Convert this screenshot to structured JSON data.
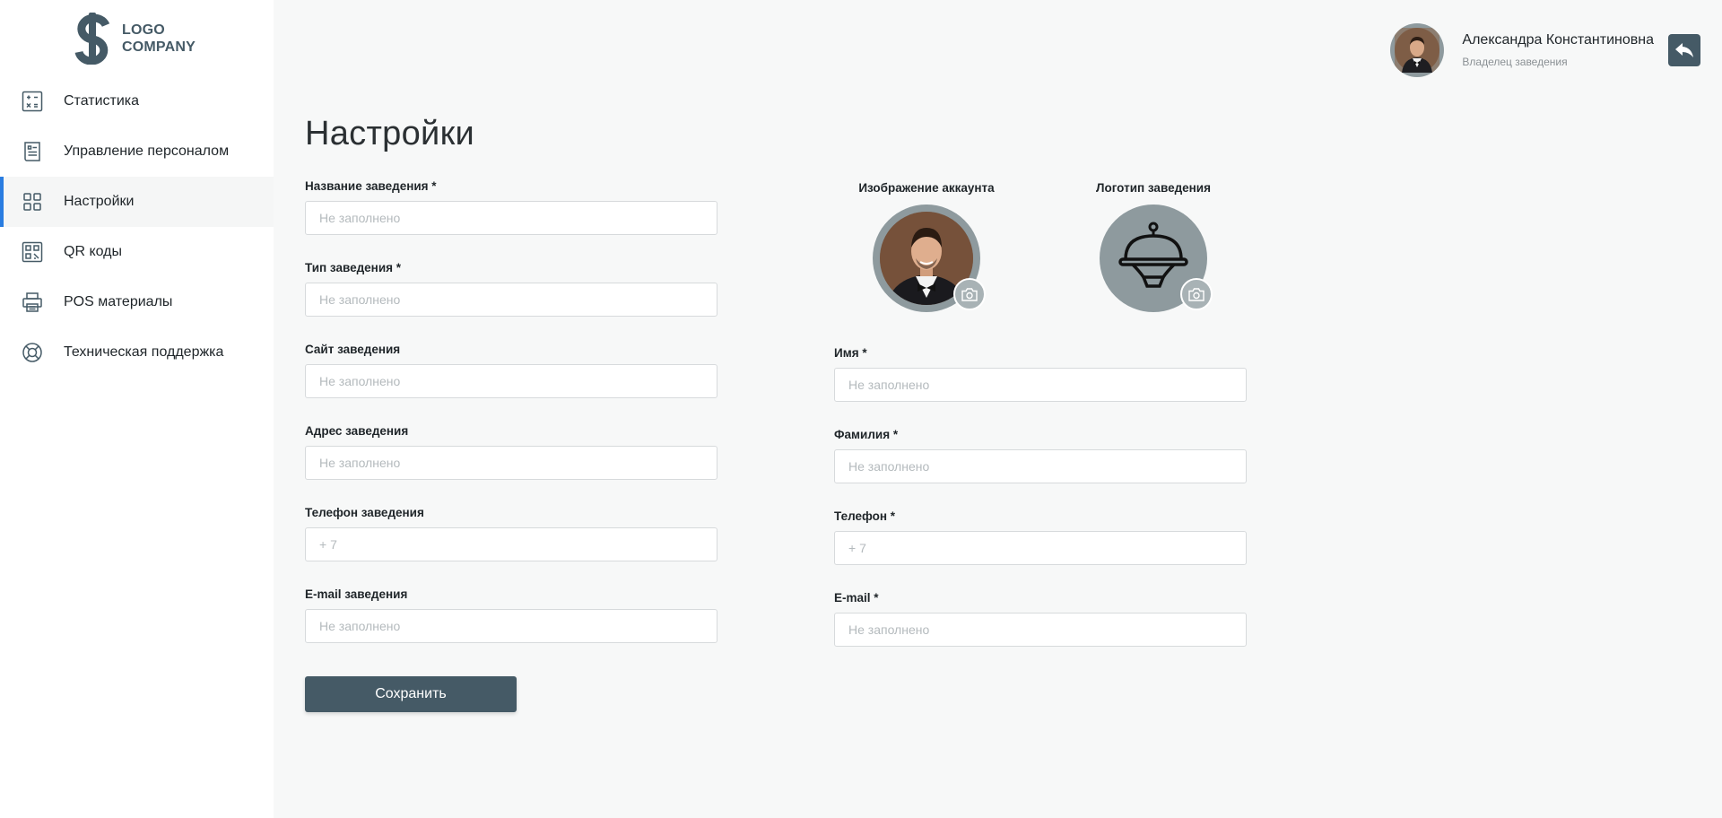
{
  "brand": {
    "logo_line1": "LOGO",
    "logo_line2": "COMPANY"
  },
  "sidebar": {
    "items": [
      {
        "label": "Статистика",
        "icon": "calculator-icon",
        "active": false
      },
      {
        "label": "Управление персоналом",
        "icon": "document-list-icon",
        "active": false
      },
      {
        "label": "Настройки",
        "icon": "grid-icon",
        "active": true
      },
      {
        "label": "QR коды",
        "icon": "qr-code-icon",
        "active": false
      },
      {
        "label": "POS материалы",
        "icon": "printer-icon",
        "active": false
      },
      {
        "label": "Техническая поддержка",
        "icon": "lifebuoy-icon",
        "active": false
      }
    ]
  },
  "header": {
    "user_name": "Александра Константиновна",
    "user_role": "Владелец заведения",
    "back_icon": "reply-arrow-icon"
  },
  "page": {
    "title": "Настройки"
  },
  "venue_form": {
    "name": {
      "label": "Название заведения *",
      "placeholder": "Не заполнено",
      "value": ""
    },
    "type": {
      "label": "Тип заведения *",
      "placeholder": "Не заполнено",
      "value": ""
    },
    "site": {
      "label": "Сайт заведения",
      "placeholder": "Не заполнено",
      "value": ""
    },
    "address": {
      "label": "Адрес заведения",
      "placeholder": "Не заполнено",
      "value": ""
    },
    "phone": {
      "label": "Телефон заведения",
      "placeholder": "+ 7",
      "value": ""
    },
    "email": {
      "label": "E-mail заведения",
      "placeholder": "Не заполнено",
      "value": ""
    },
    "save_label": "Сохранить"
  },
  "account": {
    "avatar_label": "Изображение аккаунта",
    "logo_label": "Логотип заведения",
    "first_name": {
      "label": "Имя *",
      "placeholder": "Не заполнено",
      "value": ""
    },
    "last_name": {
      "label": "Фамилия *",
      "placeholder": "Не заполнено",
      "value": ""
    },
    "phone": {
      "label": "Телефон *",
      "placeholder": "+ 7",
      "value": ""
    },
    "email": {
      "label": "E-mail *",
      "placeholder": "Не заполнено",
      "value": ""
    }
  },
  "colors": {
    "accent": "#2a7de1",
    "primary_dark": "#455a66",
    "avatar_ring": "#8e9a9e",
    "background": "#f7f8f8"
  }
}
